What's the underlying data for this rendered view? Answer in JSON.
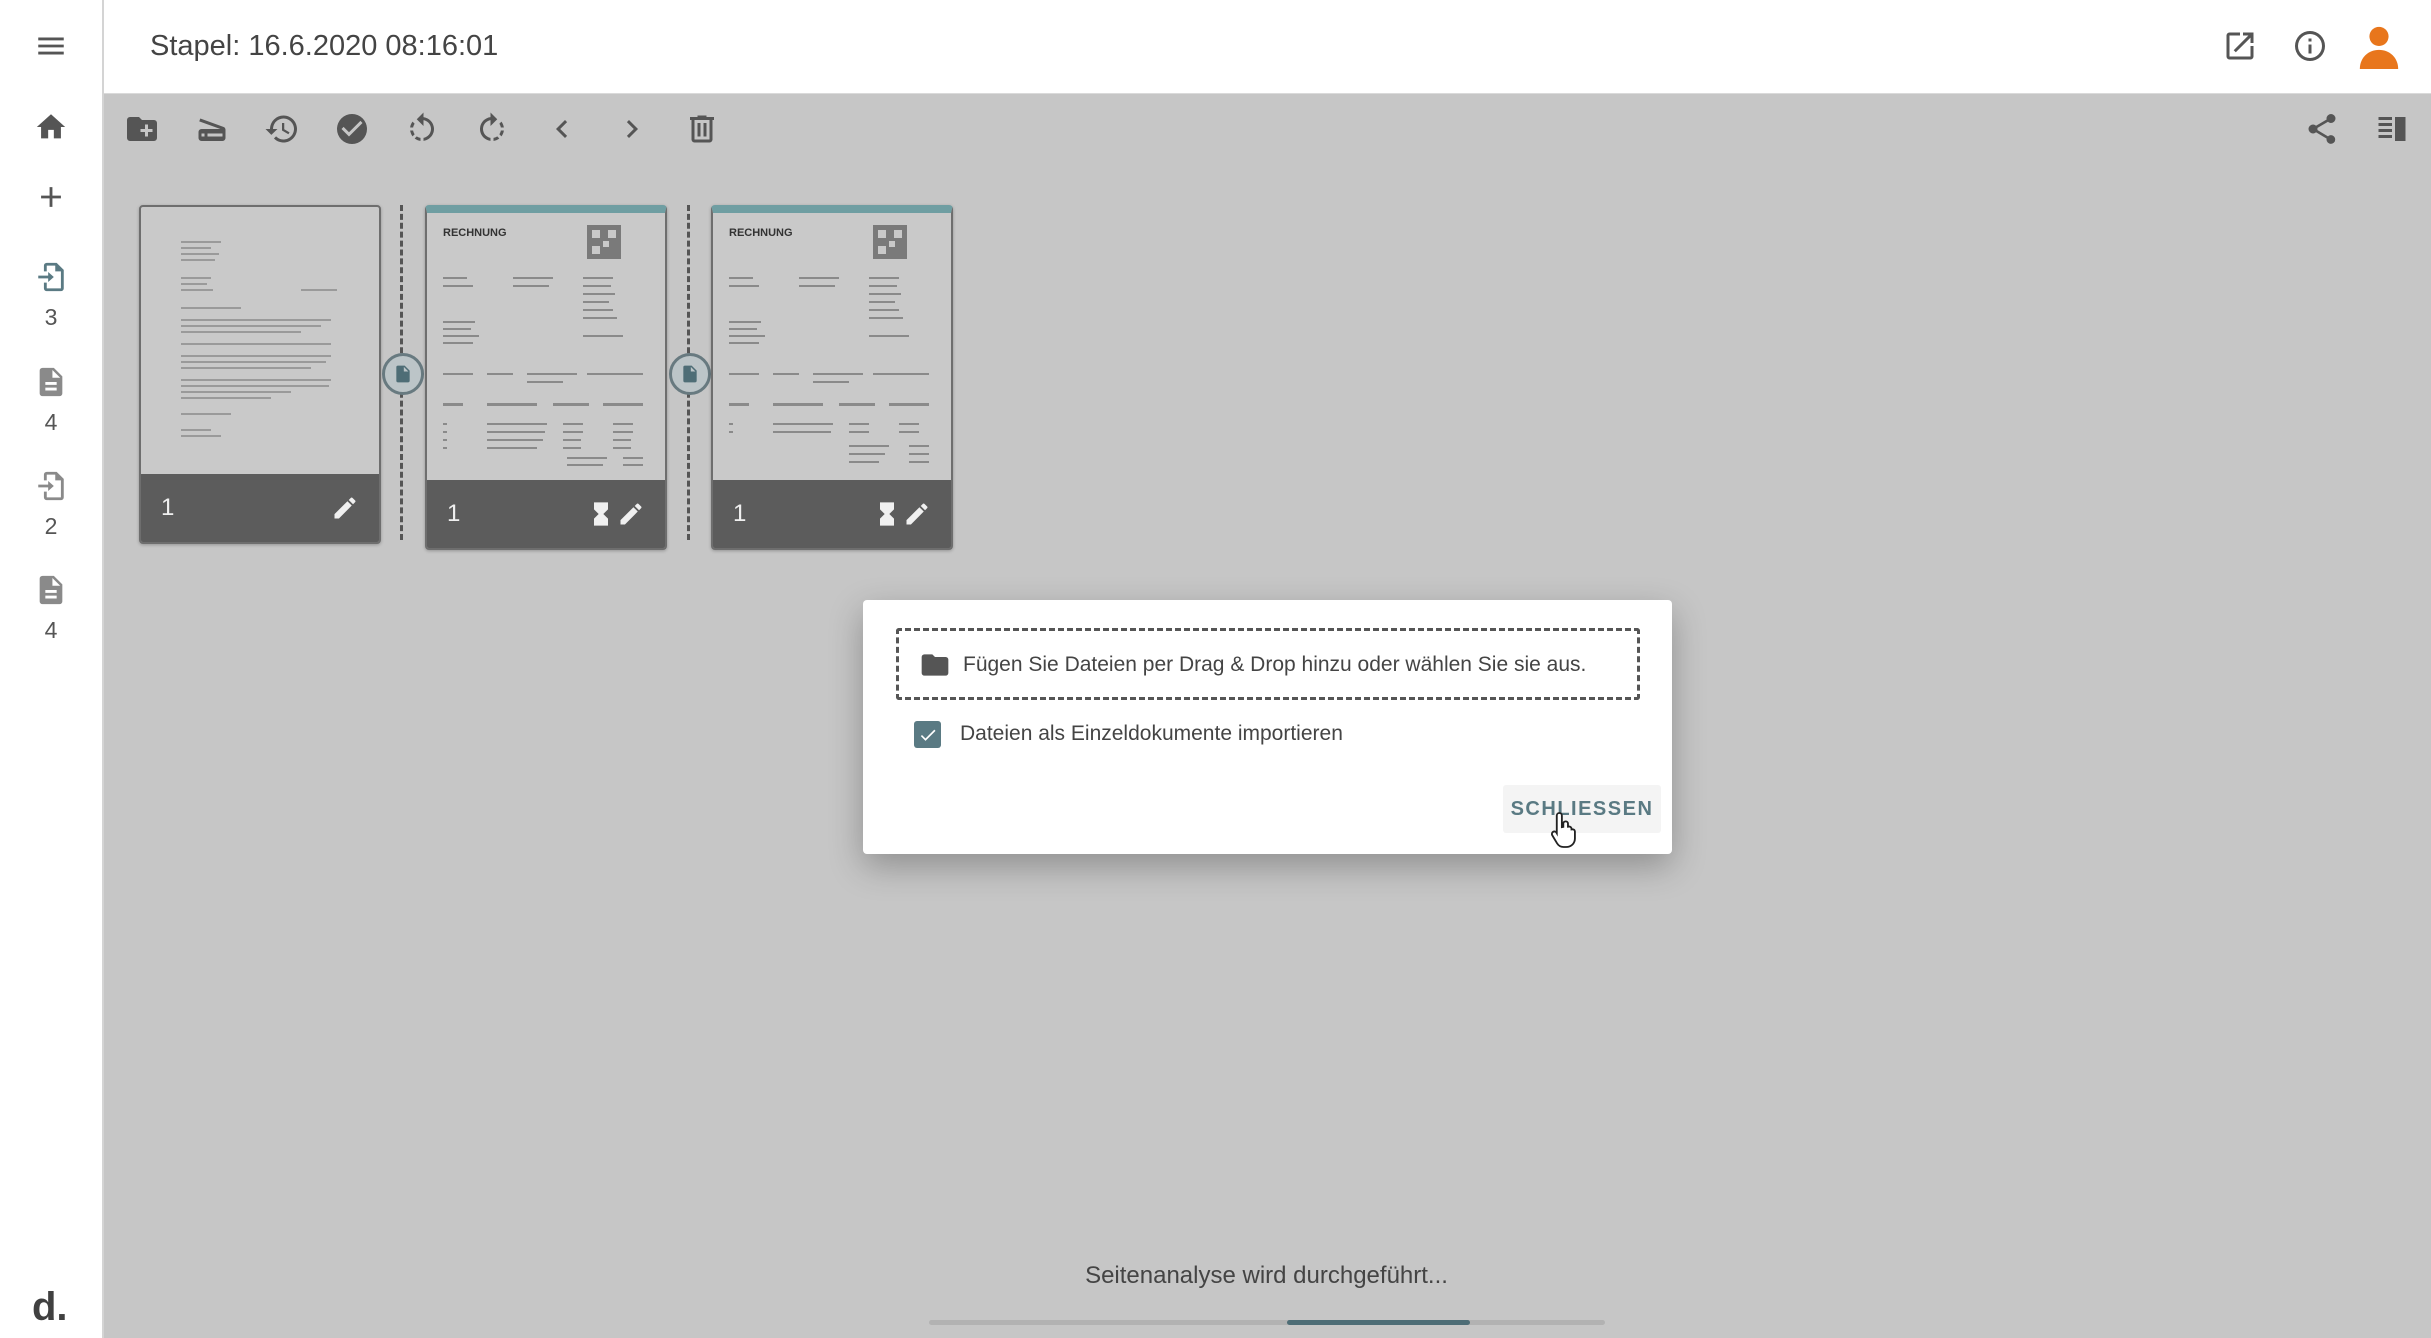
{
  "header": {
    "title": "Stapel: 16.6.2020 08:16:01"
  },
  "sidebar": {
    "items": [
      {
        "icon": "import-document-icon",
        "count": "3",
        "active": true
      },
      {
        "icon": "document-icon",
        "count": "4",
        "active": false
      },
      {
        "icon": "import-document-icon",
        "count": "2",
        "active": false
      },
      {
        "icon": "document-icon",
        "count": "4",
        "active": false
      }
    ],
    "logo": "d."
  },
  "documents": [
    {
      "page_number": "1",
      "heading": "",
      "teal": false
    },
    {
      "page_number": "1",
      "heading": "RECHNUNG",
      "teal": true
    },
    {
      "page_number": "1",
      "heading": "RECHNUNG",
      "teal": true
    }
  ],
  "dialog": {
    "dropzone_text": "Fügen Sie Dateien per Drag & Drop hinzu oder wählen Sie sie aus.",
    "checkbox_label": "Dateien als Einzeldokumente importieren",
    "checkbox_checked": true,
    "close_label": "SCHLIESSEN"
  },
  "status": {
    "text": "Seitenanalyse wird durchgeführt...",
    "progress_fraction": 0.8
  },
  "colors": {
    "accent": "#5a7a83",
    "avatar": "#e8761c",
    "teal": "#6f9ea2"
  }
}
